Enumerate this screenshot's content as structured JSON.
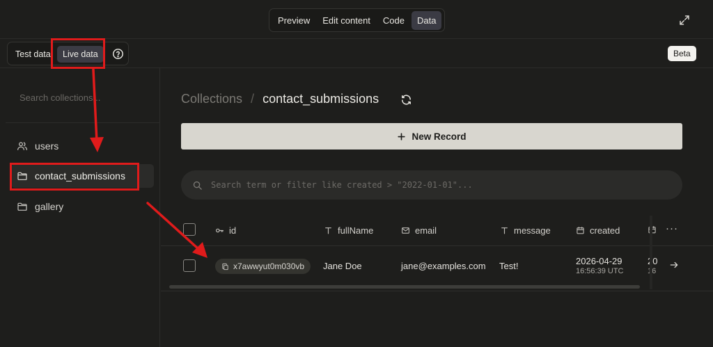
{
  "tabs": [
    {
      "label": "Preview"
    },
    {
      "label": "Edit content"
    },
    {
      "label": "Code"
    },
    {
      "label": "Data"
    }
  ],
  "active_tab": "Data",
  "data_mode": {
    "test_label": "Test data",
    "live_label": "Live data",
    "active": "Live data"
  },
  "beta_label": "Beta",
  "sidebar": {
    "search_placeholder": "Search collections...",
    "items": [
      {
        "label": "users",
        "icon": "users-icon"
      },
      {
        "label": "contact_submissions",
        "icon": "folder-icon"
      },
      {
        "label": "gallery",
        "icon": "folder-icon"
      }
    ],
    "selected": "contact_submissions"
  },
  "breadcrumb": {
    "root": "Collections",
    "separator": "/",
    "current": "contact_submissions"
  },
  "new_record_label": "New Record",
  "filter": {
    "placeholder": "Search term or filter like created > \"2022-01-01\"...",
    "value": ""
  },
  "table": {
    "columns": [
      {
        "label": "id",
        "icon": "key-icon"
      },
      {
        "label": "fullName",
        "icon": "text-icon"
      },
      {
        "label": "email",
        "icon": "mail-icon"
      },
      {
        "label": "message",
        "icon": "text-icon"
      },
      {
        "label": "created",
        "icon": "calendar-icon"
      }
    ],
    "more_label": "···",
    "rows": [
      {
        "id": "x7awwyut0m030vb",
        "fullName": "Jane Doe",
        "email": "jane@examples.com",
        "message": "Test!",
        "created_date": "2026-04-29",
        "created_time": "16:56:39 UTC",
        "updated_date_partial": "20",
        "updated_time_partial": "16"
      }
    ]
  },
  "colors": {
    "background": "#1e1e1c",
    "accent_button": "#d8d6cf",
    "annotation": "#e01b1b"
  }
}
